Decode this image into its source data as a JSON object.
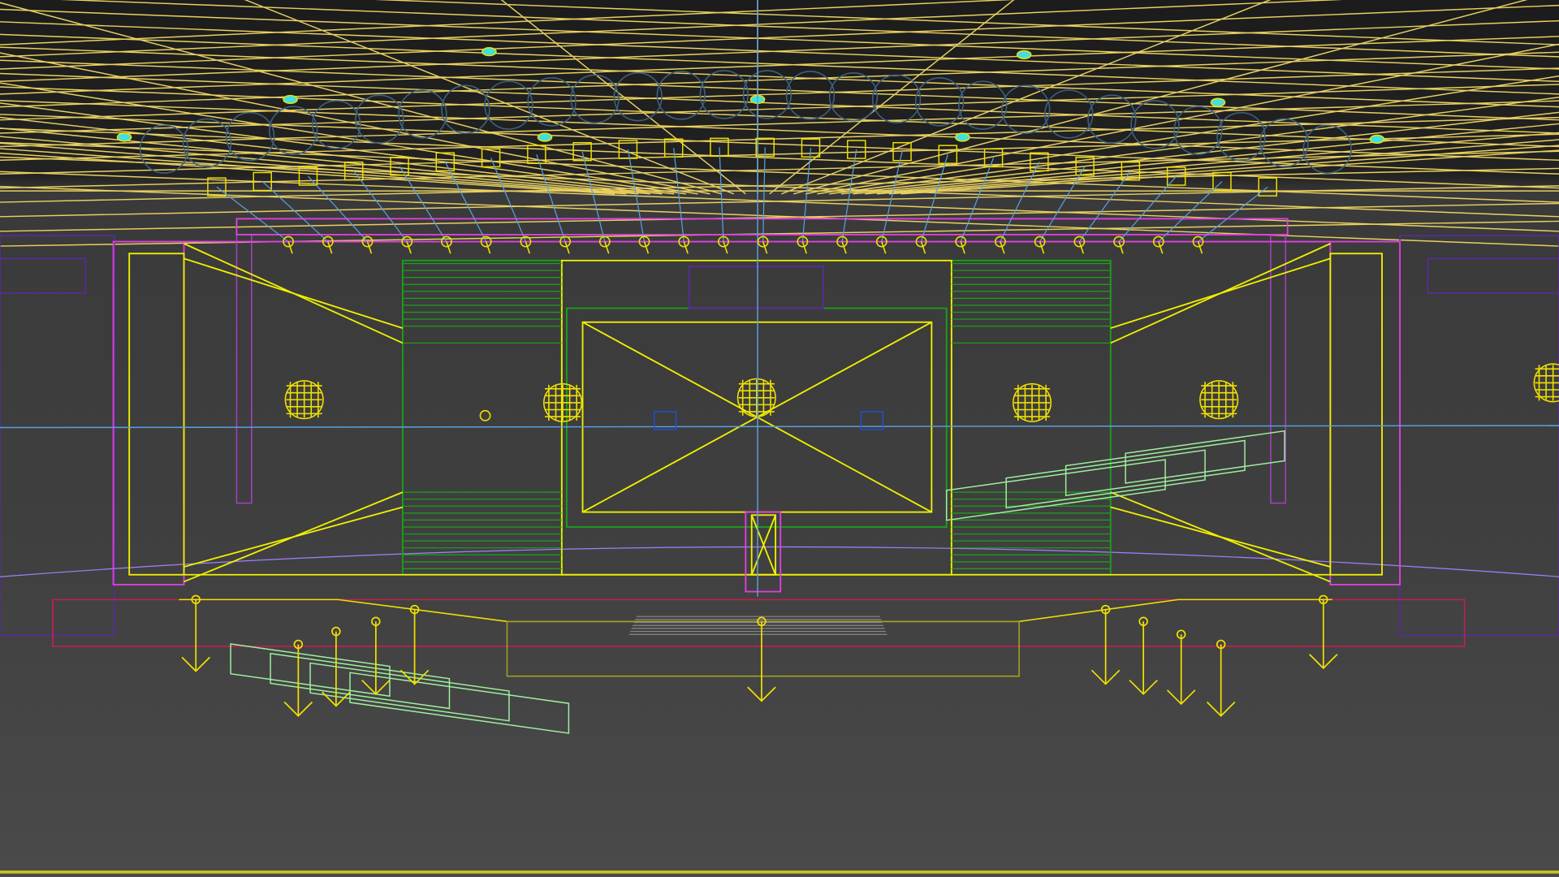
{
  "viewport": {
    "view_type": "wireframe-perspective",
    "colors": {
      "ceiling": "#e8d060",
      "light_target": "#5aa0e0",
      "fixture_ring": "#3c6080",
      "frame_magenta": "#e040e0",
      "frame_yellow": "#f0f000",
      "panel_green": "#1ca01c",
      "stair_green": "#a0f0a0",
      "floor_red": "#c02050",
      "side_purple": "#5a2aa0",
      "horizon": "#a080ff"
    }
  }
}
